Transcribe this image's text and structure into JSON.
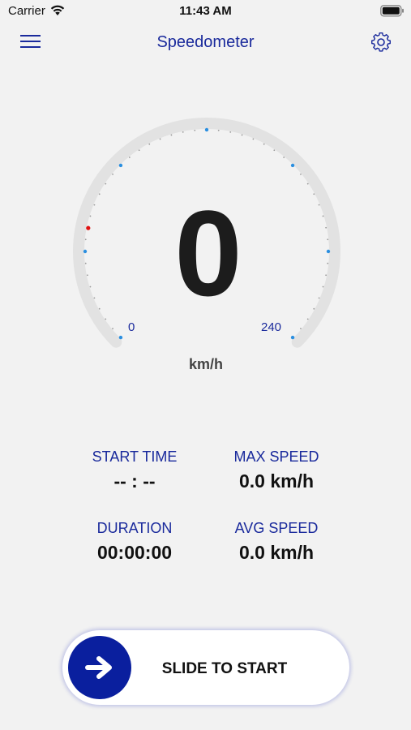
{
  "status_bar": {
    "carrier": "Carrier",
    "time": "11:43 AM",
    "icons": [
      "wifi-icon",
      "battery-icon"
    ]
  },
  "nav": {
    "title": "Speedometer",
    "left_icon": "menu-icon",
    "right_icon": "gear-icon"
  },
  "gauge": {
    "speed": "0",
    "unit": "km/h",
    "scale_min": "0",
    "scale_max": "240",
    "current_fraction": 0.0,
    "colors": {
      "track": "#e2e2e2",
      "major_tick": "#2b8fe0",
      "minor_tick": "#9a9a9a",
      "needle_marker": "#e01010"
    }
  },
  "stats": {
    "start_time": {
      "label": "START TIME",
      "value": "-- : --"
    },
    "max_speed": {
      "label": "MAX SPEED",
      "value": "0.0 km/h"
    },
    "duration": {
      "label": "DURATION",
      "value": "00:00:00"
    },
    "avg_speed": {
      "label": "AVG SPEED",
      "value": "0.0 km/h"
    }
  },
  "slider": {
    "label": "SLIDE TO START",
    "knob_icon": "arrow-right-icon",
    "accent": "#0a1f9e"
  },
  "theme": {
    "background": "#f2f2f2",
    "accent_text": "#1a2a9c"
  }
}
